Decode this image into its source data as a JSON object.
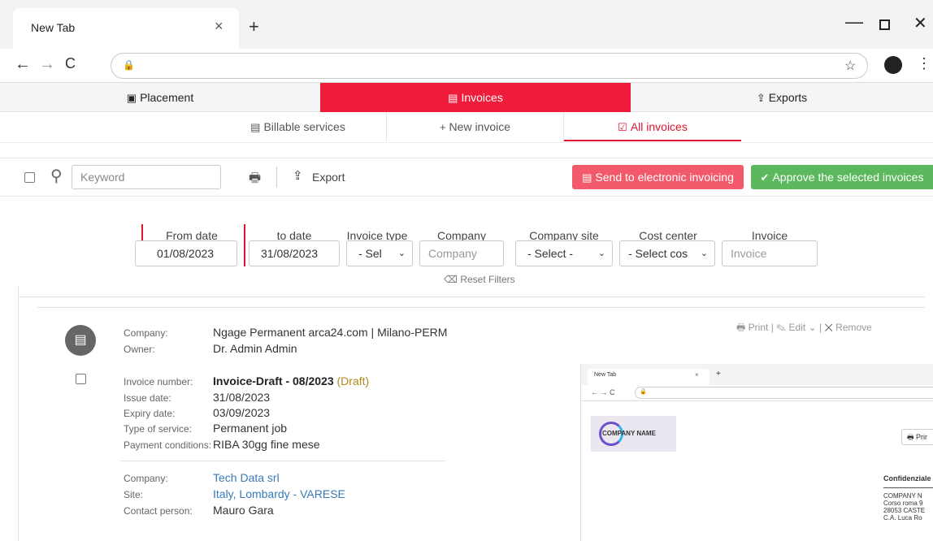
{
  "browser": {
    "tab_title": "New Tab",
    "tab_close": "×",
    "new_tab": "+",
    "nav_back": "←",
    "nav_forward": "→",
    "nav_reload": "C",
    "win_min": "—",
    "win_close": "✕",
    "kebab": "⋮",
    "star": "☆"
  },
  "main_nav": {
    "placement": "Placement",
    "invoices": "Invoices",
    "exports": "Exports",
    "active_color": "#ef1c3b"
  },
  "sub_nav": {
    "billable": "Billable services",
    "new_invoice": "New invoice",
    "all_invoices": "All invoices"
  },
  "toolbar": {
    "keyword_placeholder": "Keyword",
    "export": "Export",
    "send_electronic": "Send to electronic invoicing",
    "approve_selected": "Approve the selected invoices"
  },
  "filters": {
    "from_date_label": "From date",
    "from_date": "01/08/2023",
    "to_date_label": "to date",
    "to_date": "31/08/2023",
    "invoice_type_label": "Invoice type",
    "invoice_type": "- Sel",
    "company_label": "Company",
    "company_placeholder": "Company",
    "company_site_label": "Company site",
    "company_site": "- Select -",
    "cost_center_label": "Cost center",
    "cost_center": "- Select cos",
    "invoice_label": "Invoice",
    "invoice_placeholder": "Invoice",
    "reset": "Reset Filters"
  },
  "invoice": {
    "company_label": "Company:",
    "company": "Ngage Permanent arca24.com | Milano-PERM",
    "owner_label": "Owner:",
    "owner": "Dr. Admin Admin",
    "actions": {
      "print": "Print",
      "edit": "Edit",
      "remove": "Remove"
    },
    "number_label": "Invoice number:",
    "number": "Invoice-Draft - 08/2023",
    "status": "(Draft)",
    "issue_label": "Issue date:",
    "issue": "31/08/2023",
    "expiry_label": "Expiry date:",
    "expiry": "03/09/2023",
    "service_label": "Type of service:",
    "service": "Permanent job",
    "payment_label": "Payment conditions:",
    "payment": "RIBA 30gg fine mese",
    "client_company_label": "Company:",
    "client_company": "Tech Data srl",
    "site_label": "Site:",
    "site": "Italy, Lombardy - VARESE",
    "contact_label": "Contact person:",
    "contact": "Mauro Gara"
  },
  "preview": {
    "tab_title": "New Tab",
    "logo_text": "COMPANY NAME",
    "print": "Prir",
    "confidential": "Confidenziale",
    "address_1": "COMPANY N",
    "address_2": "Corso roma 9",
    "address_3": "28053 CASTE",
    "address_4": "C.A. Luca Ro"
  }
}
